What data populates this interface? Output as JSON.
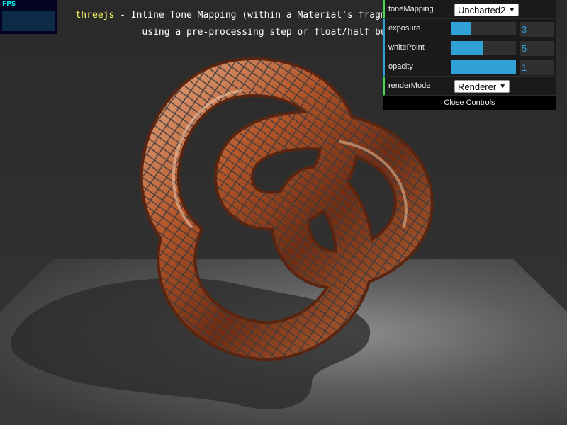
{
  "stats": {
    "label": "FPS"
  },
  "info": {
    "link_text": "threejs",
    "line1_rest": " - Inline Tone Mapping (within a Material's fragment shader) without",
    "line2": "using a pre-processing step or float/half buffers b"
  },
  "gui": {
    "toneMapping": {
      "label": "toneMapping",
      "value": "Uncharted2"
    },
    "exposure": {
      "label": "exposure",
      "value": "3",
      "fraction": 0.3
    },
    "whitePoint": {
      "label": "whitePoint",
      "value": "5",
      "fraction": 0.5
    },
    "opacity": {
      "label": "opacity",
      "value": "1",
      "fraction": 1.0
    },
    "renderMode": {
      "label": "renderMode",
      "value": "Renderer"
    },
    "close_label": "Close Controls"
  },
  "colors": {
    "accent_number": "#2fa1d6",
    "accent_select": "#4cd35a",
    "link": "#ffff66",
    "copper": "#b5562a"
  },
  "scene": {
    "object": "torus-knot",
    "material": "copper-tiles"
  }
}
